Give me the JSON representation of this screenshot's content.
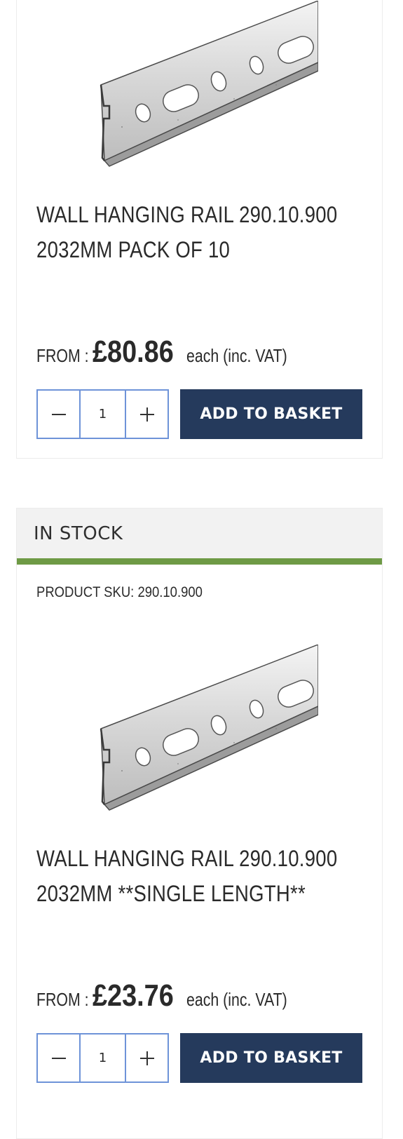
{
  "products": [
    {
      "title": "WALL HANGING RAIL 290.10.900\n2032MM PACK OF 10",
      "from_label": "FROM :",
      "price": "£80.86",
      "vat_note": "each (inc. VAT)",
      "quantity": "1",
      "add_label": "ADD TO BASKET"
    },
    {
      "stock_status": "IN STOCK",
      "sku_text": "PRODUCT SKU: 290.10.900",
      "title": "WALL HANGING RAIL 290.10.900\n2032MM **SINGLE LENGTH**",
      "from_label": "FROM :",
      "price": "£23.76",
      "vat_note": "each (inc. VAT)",
      "quantity": "1",
      "add_label": "ADD TO BASKET"
    }
  ],
  "icons": {
    "decrement": "minus-icon",
    "increment": "plus-icon"
  },
  "colors": {
    "stock_accent": "#6e9a45",
    "button_bg": "#253a5c",
    "qty_border": "#6e93d8"
  }
}
